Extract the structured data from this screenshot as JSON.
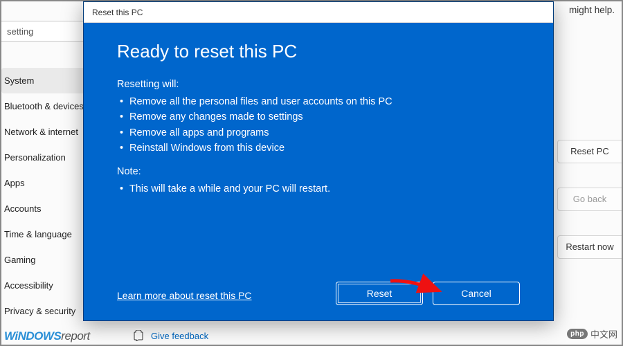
{
  "bg": {
    "help_tail": "might help.",
    "search_value": "setting",
    "nav": [
      "System",
      "Bluetooth & devices",
      "Network & internet",
      "Personalization",
      "Apps",
      "Accounts",
      "Time & language",
      "Gaming",
      "Accessibility",
      "Privacy & security"
    ],
    "nav_selected_index": 0,
    "right_buttons": [
      {
        "label": "Reset PC",
        "dim": false
      },
      {
        "label": "Go back",
        "dim": true
      },
      {
        "label": "Restart now",
        "dim": false
      }
    ],
    "feedback_label": "Give feedback"
  },
  "modal": {
    "titlebar": "Reset this PC",
    "heading": "Ready to reset this PC",
    "resetting_label": "Resetting will:",
    "resetting_items": [
      "Remove all the personal files and user accounts on this PC",
      "Remove any changes made to settings",
      "Remove all apps and programs",
      "Reinstall Windows from this device"
    ],
    "note_label": "Note:",
    "note_items": [
      "This will take a while and your PC will restart."
    ],
    "learn_more": "Learn more about reset this PC",
    "reset_btn": "Reset",
    "cancel_btn": "Cancel"
  },
  "watermarks": {
    "left_a": "WiNDOWS",
    "left_b": "report",
    "right_badge": "php",
    "right_text": "中文网"
  },
  "colors": {
    "accent": "#0066cc"
  }
}
